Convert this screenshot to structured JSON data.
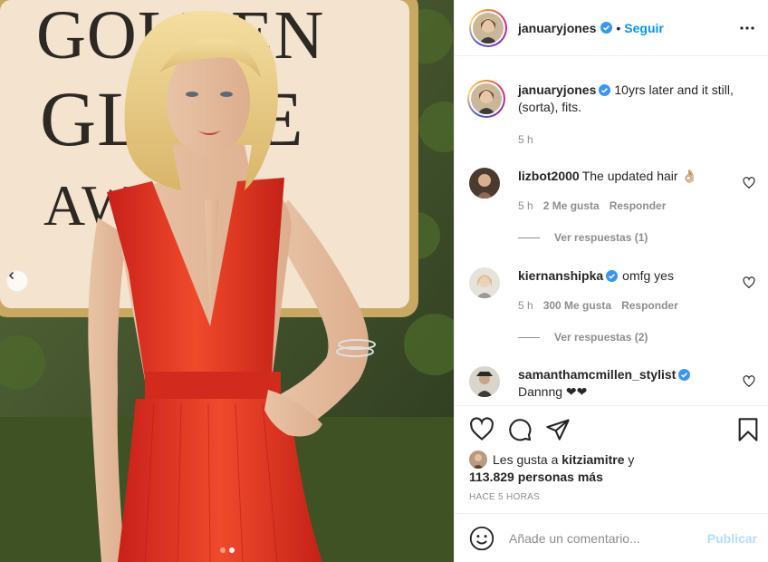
{
  "post": {
    "author": "januaryjones",
    "separator": "•",
    "follow_label": "Seguir"
  },
  "caption": {
    "user": "januaryjones",
    "text": "10yrs later and it still, (sorta), fits.",
    "time": "5 h"
  },
  "photo_sign": {
    "line1": "GOLDEN",
    "line2": "GLOBE",
    "line3": "AWARDS"
  },
  "comments": [
    {
      "user": "lizbot2000",
      "verified": false,
      "text": "The updated hair 👌🏼",
      "time": "5 h",
      "likes": "2 Me gusta",
      "reply": "Responder",
      "view_replies": "Ver respuestas (1)"
    },
    {
      "user": "kiernanshipka",
      "verified": true,
      "text": "omfg yes",
      "time": "5 h",
      "likes": "300 Me gusta",
      "reply": "Responder",
      "view_replies": "Ver respuestas (2)"
    },
    {
      "user": "samanthamcmillen_stylist",
      "verified": true,
      "text": "Dannng ❤❤"
    }
  ],
  "likes": {
    "prefix": "Les gusta a",
    "user": "kitziamitre",
    "and": "y",
    "count_text": "113.829 personas más"
  },
  "timestamp": "HACE 5 HORAS",
  "add_comment": {
    "placeholder": "Añade un comentario...",
    "publish_label": "Publicar"
  },
  "carousel": {
    "count": 2,
    "active_index": 1
  },
  "colors": {
    "accent": "#0095f6",
    "dress": "#e8321f",
    "text": "#262626",
    "muted": "#8e8e8e",
    "publish_disabled": "#b2dffc"
  },
  "icons": [
    "more-icon",
    "verified-icon",
    "heart-icon",
    "comment-icon",
    "share-icon",
    "bookmark-icon",
    "emoji-icon",
    "chevron-left-icon"
  ]
}
